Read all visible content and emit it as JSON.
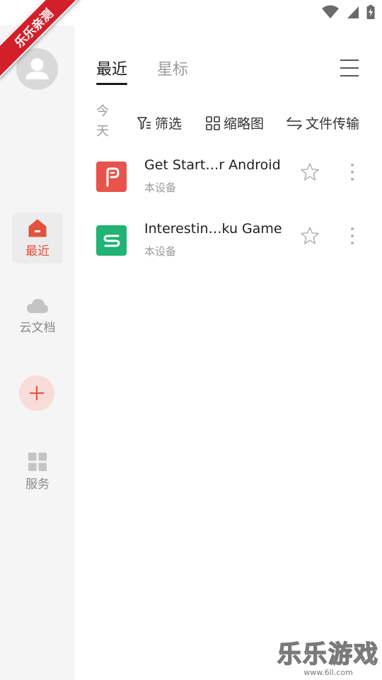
{
  "status_bar": {
    "icons": [
      "wifi-icon",
      "signal-icon",
      "battery-charging-icon"
    ]
  },
  "ribbon": {
    "text": "乐乐亲测"
  },
  "sidebar": {
    "items": [
      {
        "label": "最近",
        "icon": "home-icon",
        "active": true
      },
      {
        "label": "云文档",
        "icon": "cloud-icon",
        "active": false
      },
      {
        "label": "服务",
        "icon": "grid-icon",
        "active": false
      }
    ],
    "add_icon": "plus-icon"
  },
  "tabs": [
    {
      "label": "最近",
      "active": true
    },
    {
      "label": "星标",
      "active": false
    }
  ],
  "filter_bar": {
    "date_group": "今天",
    "filter_label": "筛选",
    "thumbnail_label": "缩略图",
    "transfer_label": "文件传输"
  },
  "files": [
    {
      "name": "Get Start…r Android",
      "location": "本设备",
      "icon": "presentation-file-icon",
      "color": "#e8534b"
    },
    {
      "name": "Interestin…ku Game",
      "location": "本设备",
      "icon": "spreadsheet-file-icon",
      "color": "#1fb374"
    }
  ],
  "watermark": {
    "title": "乐乐游戏",
    "url": "www.6ll.com"
  },
  "colors": {
    "accent": "#e2523f",
    "sidebar_bg": "#f5f5f5"
  }
}
